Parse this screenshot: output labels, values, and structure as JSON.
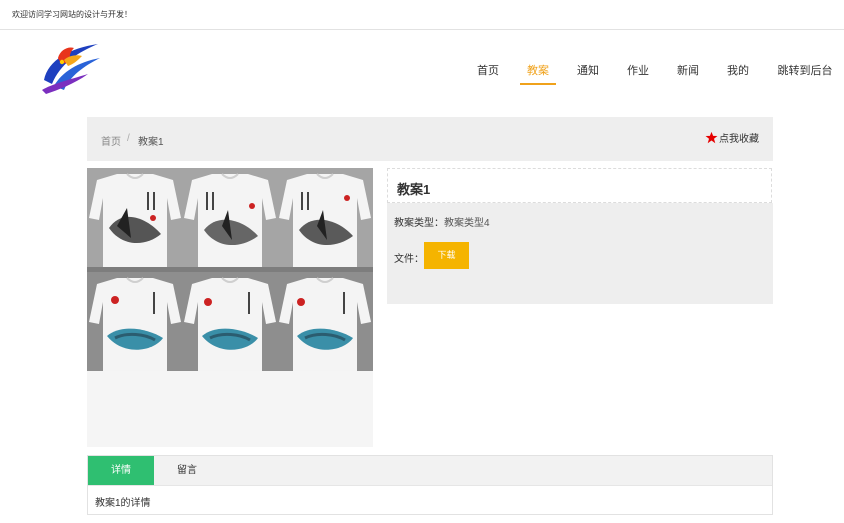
{
  "header": {
    "welcome": "欢迎访问学习网站的设计与开发！"
  },
  "nav": {
    "items": [
      {
        "label": "首页"
      },
      {
        "label": "教案"
      },
      {
        "label": "通知"
      },
      {
        "label": "作业"
      },
      {
        "label": "新闻"
      },
      {
        "label": "我的"
      },
      {
        "label": "跳转到后台"
      }
    ],
    "active_index": 1,
    "active_color": "#f0a21b"
  },
  "breadcrumb": {
    "home": "首页",
    "separator": "/",
    "current": "教案1"
  },
  "favorite": {
    "label": "点我收藏",
    "icon": "star-icon",
    "icon_color": "#e50000"
  },
  "detail": {
    "title": "教案1",
    "type_label": "教案类型：",
    "type_value": "教案类型4",
    "file_label": "文件：",
    "download_label": "下载",
    "download_color": "#f5b400"
  },
  "tabs": {
    "items": [
      {
        "label": "详情"
      },
      {
        "label": "留言"
      }
    ],
    "active_color": "#2fbf71",
    "content": "教案1的详情"
  }
}
